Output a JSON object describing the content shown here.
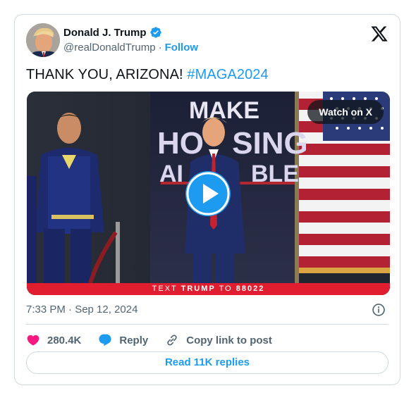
{
  "author": {
    "name": "Donald J. Trump",
    "handle": "@realDonaldTrump",
    "separator": "·",
    "follow_label": "Follow"
  },
  "tweet": {
    "text": "THANK YOU, ARIZONA! ",
    "hashtag": "#MAGA2024"
  },
  "media": {
    "watch_label": "Watch on X",
    "sign_top": "MAKE",
    "sign_mid_left": "HO",
    "sign_mid_right": "SING",
    "sign_bot_left": "AI",
    "sign_bot_right": "BLE",
    "bar_prefix": "TEXT",
    "bar_keyword": "TRUMP",
    "bar_to": "TO",
    "bar_number": "88022"
  },
  "meta": {
    "timestamp": "7:33 PM · Sep 12, 2024"
  },
  "actions": {
    "likes": "280.4K",
    "reply_label": "Reply",
    "copy_label": "Copy link to post"
  },
  "replies_button": "Read 11K replies",
  "colors": {
    "accent": "#1d9bf0",
    "like": "#f91880",
    "text_secondary": "#536471",
    "border": "#cfd9de",
    "bar_red": "#e01e2f"
  },
  "icons": [
    "verified-badge-icon",
    "x-logo-icon",
    "play-icon",
    "info-icon",
    "heart-icon",
    "reply-bubble-icon",
    "link-icon"
  ]
}
